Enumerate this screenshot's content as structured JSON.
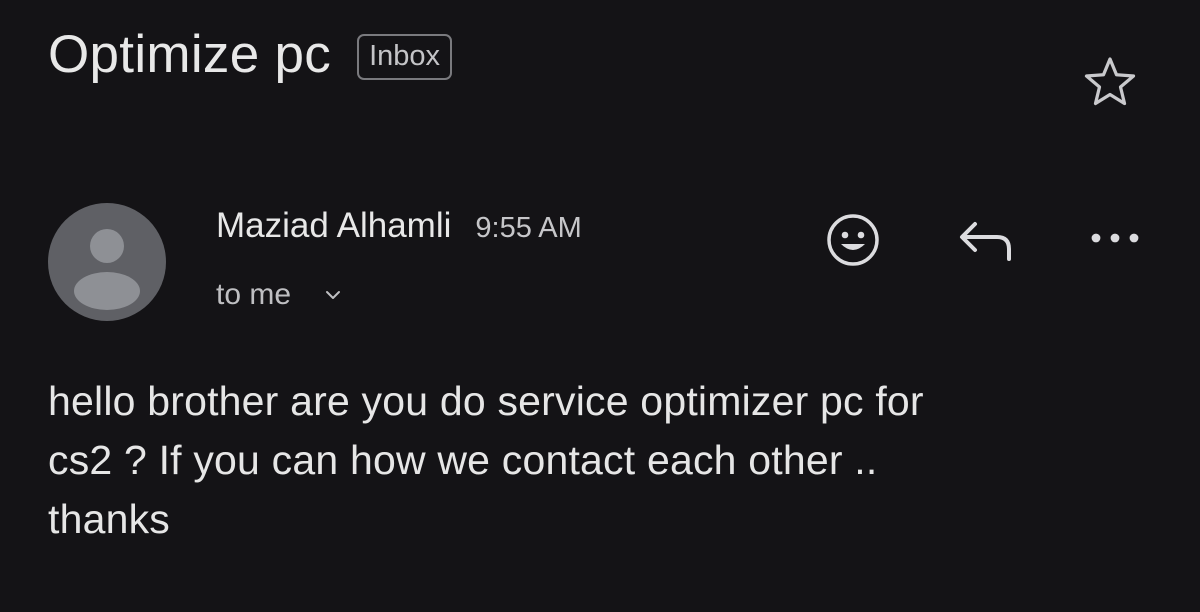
{
  "email": {
    "subject": "Optimize pc",
    "label": "Inbox",
    "sender_name": "Maziad Alhamli",
    "time": "9:55 AM",
    "recipient": "to me",
    "body_lines": [
      "hello brother are you do service optimizer pc for",
      "cs2 ? If you can how we contact each other ..",
      "thanks"
    ]
  },
  "icons": {
    "star": "star-outline-icon",
    "avatar": "default-person-avatar",
    "emoji": "add-reaction-emoji-icon",
    "reply": "reply-arrow-icon",
    "more": "more-horizontal-dots-icon",
    "expand": "chevron-down-icon"
  },
  "colors": {
    "background": "#141316",
    "text_primary": "#e8e8e8",
    "text_secondary": "#c6c6c9",
    "avatar_bg": "#5f6065",
    "avatar_fg": "#8e9095"
  }
}
